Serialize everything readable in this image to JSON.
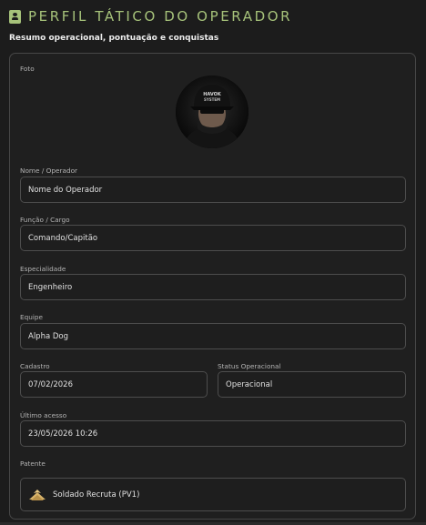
{
  "header": {
    "title": "PERFIL TÁTICO DO OPERADOR",
    "subtitle": "Resumo operacional, pontuação e conquistas",
    "icon": "id-badge-icon"
  },
  "colors": {
    "accent": "#a6c27a",
    "background": "#1c1c1c",
    "border": "#4d4d4d"
  },
  "profile": {
    "photo": {
      "label": "Foto",
      "cap_text_line1": "HAVOK",
      "cap_text_line2": "SYSTEM"
    },
    "name": {
      "label": "Nome / Operador",
      "value": "Nome do Operador"
    },
    "role": {
      "label": "Função / Cargo",
      "value": "Comando/Capitão"
    },
    "specialty": {
      "label": "Especialidade",
      "value": "Engenheiro"
    },
    "team": {
      "label": "Equipe",
      "value": "Alpha Dog"
    },
    "registered": {
      "label": "Cadastro",
      "value": "07/02/2026"
    },
    "status": {
      "label": "Status Operacional",
      "value": "Operacional"
    },
    "last_access": {
      "label": "Último acesso",
      "value": "23/05/2026 10:26"
    },
    "rank": {
      "label": "Patente",
      "value": "Soldado Recruta (PV1)",
      "icon": "rank-insignia-icon"
    }
  }
}
